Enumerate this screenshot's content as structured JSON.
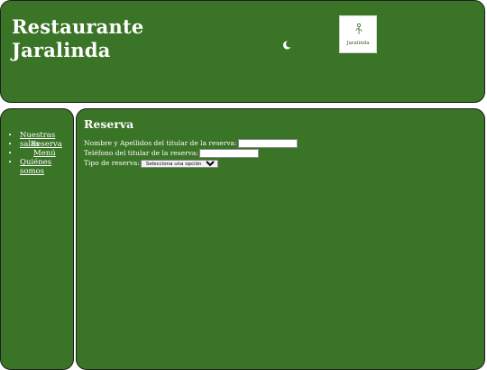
{
  "header": {
    "title_line1": "Restaurante",
    "title_line2": "Jaralinda",
    "logo_text": "Jaralinda",
    "icon": "moon-icon"
  },
  "nav": {
    "items": [
      {
        "label": "Nuestras salas"
      },
      {
        "label": "Reserva"
      },
      {
        "label": "Menú"
      },
      {
        "label": "Quiénes somos"
      }
    ]
  },
  "main": {
    "heading": "Reserva",
    "form": {
      "name_label": "Nombre y Apellidos del titular de la reserva:",
      "name_value": "",
      "phone_label": "Teléfono del titular de la reserva:",
      "phone_value": "",
      "type_label": "Tipo de reserva:",
      "type_selected": "Selecciona una opción"
    }
  },
  "colors": {
    "panel_green": "#3a7426",
    "text": "#ffffff",
    "border": "#1f1f1f"
  }
}
